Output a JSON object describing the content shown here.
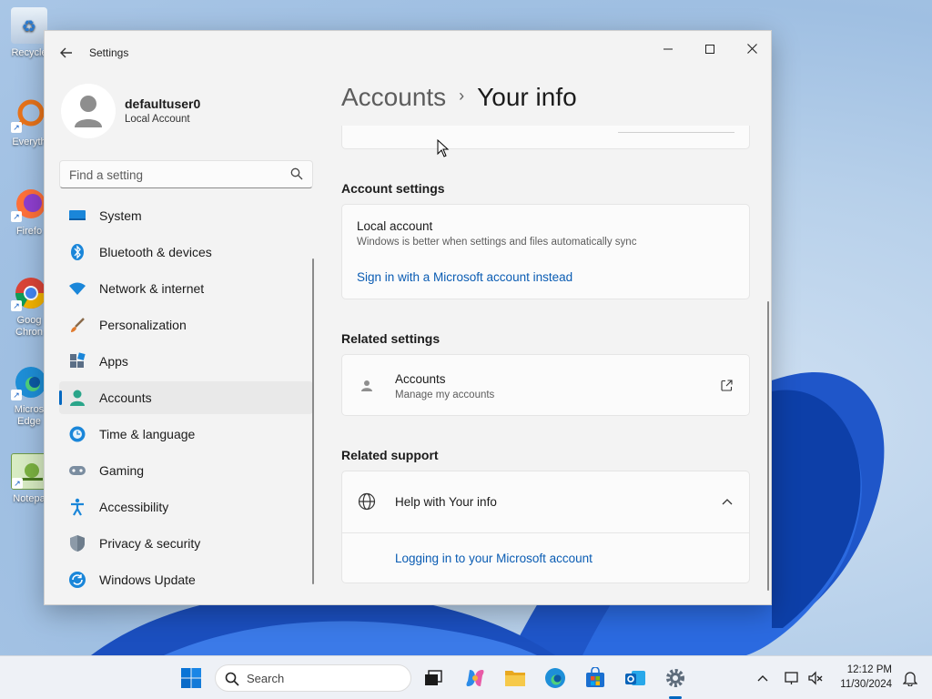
{
  "window": {
    "title": "Settings",
    "back_icon": "back-arrow-icon"
  },
  "profile": {
    "name": "defaultuser0",
    "account_type": "Local Account"
  },
  "search": {
    "placeholder": "Find a setting"
  },
  "nav": [
    {
      "label": "System",
      "icon": "system-icon",
      "active": false
    },
    {
      "label": "Bluetooth & devices",
      "icon": "bluetooth-icon",
      "active": false
    },
    {
      "label": "Network & internet",
      "icon": "network-icon",
      "active": false
    },
    {
      "label": "Personalization",
      "icon": "brush-icon",
      "active": false
    },
    {
      "label": "Apps",
      "icon": "apps-icon",
      "active": false
    },
    {
      "label": "Accounts",
      "icon": "accounts-icon",
      "active": true
    },
    {
      "label": "Time & language",
      "icon": "clock-globe-icon",
      "active": false
    },
    {
      "label": "Gaming",
      "icon": "gamepad-icon",
      "active": false
    },
    {
      "label": "Accessibility",
      "icon": "accessibility-icon",
      "active": false
    },
    {
      "label": "Privacy & security",
      "icon": "shield-icon",
      "active": false
    },
    {
      "label": "Windows Update",
      "icon": "update-icon",
      "active": false
    }
  ],
  "breadcrumb": {
    "parent": "Accounts",
    "separator": "›",
    "current": "Your info"
  },
  "account_settings": {
    "title": "Account settings",
    "heading": "Local account",
    "description": "Windows is better when settings and files automatically sync",
    "link": "Sign in with a Microsoft account instead"
  },
  "related_settings": {
    "title": "Related settings",
    "item_title": "Accounts",
    "item_subtitle": "Manage my accounts"
  },
  "related_support": {
    "title": "Related support",
    "item_title": "Help with Your info",
    "expanded": true,
    "link": "Logging in to your Microsoft account"
  },
  "desktop_icons": [
    {
      "label": "Recycle"
    },
    {
      "label": "Everyth"
    },
    {
      "label": "Firefo"
    },
    {
      "label": "Goog Chron"
    },
    {
      "label": "Micros Edge"
    },
    {
      "label": "Notepa"
    }
  ],
  "taskbar": {
    "search_label": "Search",
    "time": "12:12 PM",
    "date": "11/30/2024"
  },
  "colors": {
    "accent": "#0067c0",
    "link": "#0a5cb3",
    "window_bg": "#f3f3f3"
  }
}
